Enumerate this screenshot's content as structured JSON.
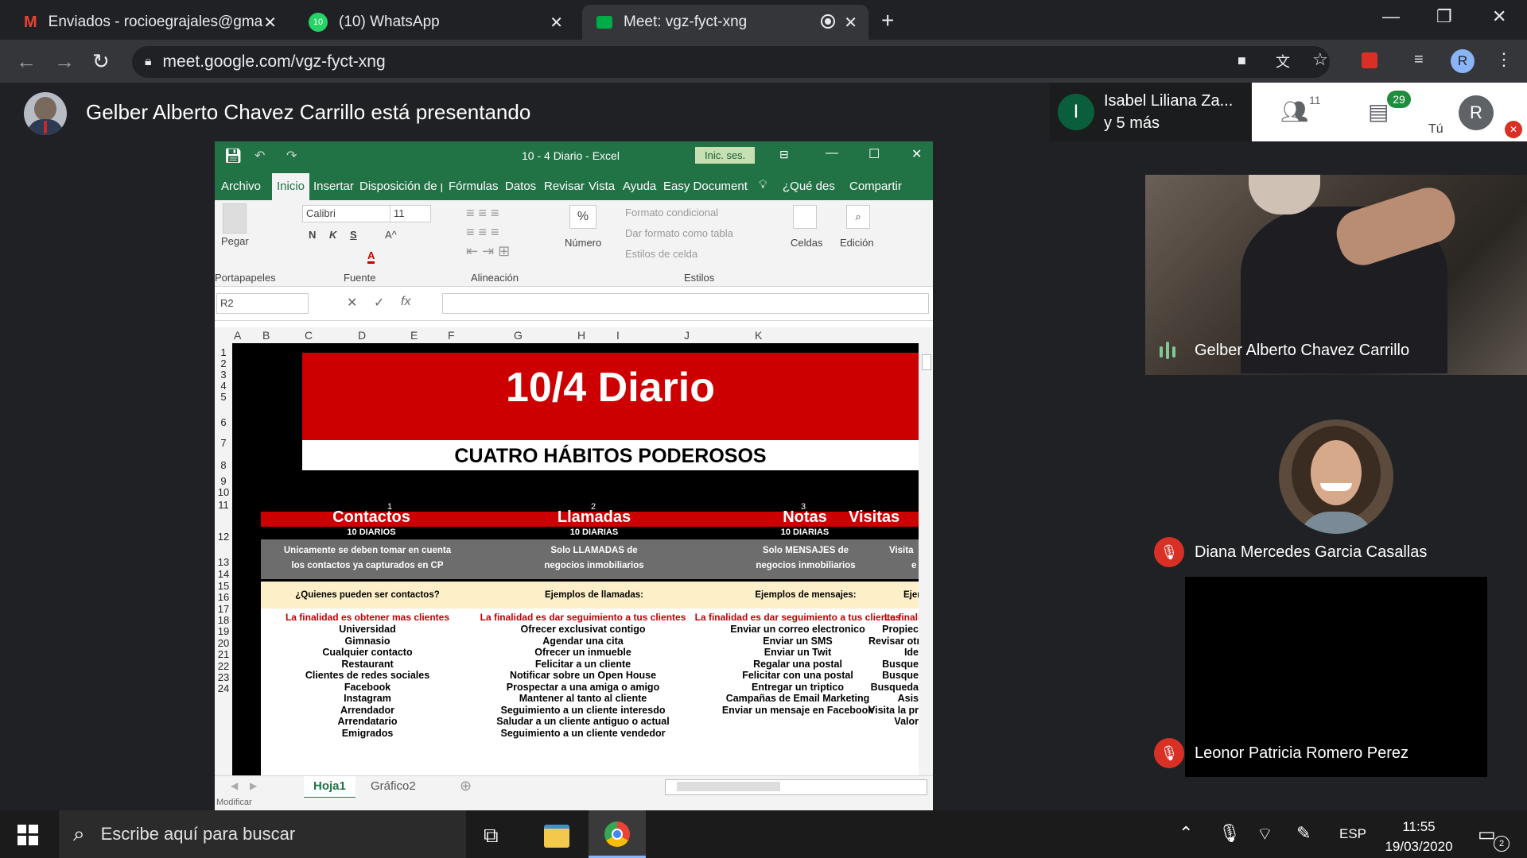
{
  "browser": {
    "tabs": [
      {
        "title": "Enviados - rocioegrajales@gmail",
        "icon": "gmail-icon"
      },
      {
        "title": "(10) WhatsApp",
        "badge": "10",
        "icon": "whatsapp-icon"
      },
      {
        "title": "Meet: vgz-fyct-xng",
        "icon": "meet-icon"
      }
    ],
    "url": "meet.google.com/vgz-fyct-xng",
    "profile_initial": "R"
  },
  "meet": {
    "presenter_text": "Gelber Alberto Chavez Carrillo está presentando",
    "people_summary_name": "Isabel Liliana Za...",
    "people_summary_more": "y 5 más",
    "people_avatar_initial": "I",
    "participants_count": "11",
    "chat_count": "29",
    "self_label": "Tú",
    "self_initial": "R",
    "tiles": [
      {
        "name": "Gelber Alberto Chavez Carrillo"
      },
      {
        "name": "Diana Mercedes Garcia Casallas"
      },
      {
        "name": "Leonor Patricia Romero Perez"
      }
    ]
  },
  "excel": {
    "window_title": "10 - 4 Diario  -  Excel",
    "signin": "Inic. ses.",
    "tabs": [
      "Archivo",
      "Inicio",
      "Insertar",
      "Disposición de p",
      "Fórmulas",
      "Datos",
      "Revisar",
      "Vista",
      "Ayuda",
      "Easy Document",
      "¿Qué des",
      "Compartir"
    ],
    "ribbon": {
      "paste": "Pegar",
      "clipboard": "Portapapeles",
      "font_name": "Calibri",
      "font_size": "11",
      "bold": "N",
      "italic": "K",
      "underline": "S",
      "font_group": "Fuente",
      "align_group": "Alineación",
      "number": "Número",
      "number_sym": "%",
      "cond_format": "Formato condicional",
      "table_format": "Dar formato como tabla",
      "cell_styles": "Estilos de celda",
      "styles_group": "Estilos",
      "cells": "Celdas",
      "edit": "Edición"
    },
    "name_box": "R2",
    "fx": "fx",
    "columns": [
      "A",
      "B",
      "C",
      "D",
      "E",
      "F",
      "G",
      "H",
      "I",
      "J",
      "K"
    ],
    "rows": [
      "1",
      "2",
      "3",
      "4",
      "5",
      "6",
      "7",
      "8",
      "9",
      "10",
      "11",
      "12",
      "13",
      "14",
      "15",
      "16",
      "17",
      "18",
      "19",
      "20",
      "21",
      "22",
      "23",
      "24"
    ],
    "sheet": {
      "title": "10/4 Diario",
      "subtitle": "CUATRO HÁBITOS PODEROSOS",
      "numbers": [
        "1",
        "2",
        "3"
      ],
      "headers": [
        "Contactos",
        "Llamadas",
        "Notas",
        "Visitas"
      ],
      "subheaders": [
        "10 DIARIOS",
        "10 DIARIAS",
        "10 DIARIAS"
      ],
      "desc": [
        [
          "Unicamente se deben tomar en cuenta",
          "los contactos ya capturados en CP"
        ],
        [
          "Solo LLAMADAS de",
          "negocios inmobiliarios"
        ],
        [
          "Solo MENSAJES de",
          "negocios inmobiliarios"
        ],
        [
          "Visita",
          "e"
        ]
      ],
      "questions": [
        "¿Quienes pueden ser contactos?",
        "Ejemplos de llamadas:",
        "Ejemplos de mensajes:",
        "Ejem"
      ],
      "goals": [
        "La finalidad es obtener mas clientes",
        "La finalidad es dar seguimiento a tus clientes",
        "La finalidad es dar seguimiento a tus clientes",
        "La finalidad"
      ],
      "col1": [
        "Universidad",
        "Gimnasio",
        "Cualquier contacto",
        "Restaurant",
        "Clientes de redes sociales",
        "Facebook",
        "Instagram",
        "Arrendador",
        "Arrendatario",
        "Emigrados"
      ],
      "col2": [
        "Ofrecer exclusivat contigo",
        "Agendar una cita",
        "Ofrecer un inmueble",
        "Felicitar a un cliente",
        "Notificar sobre un Open House",
        "Prospectar a una amiga o amigo",
        "Mantener al tanto al cliente",
        "Seguimiento a un cliente interesdo",
        "Saludar a un cliente antiguo o actual",
        "Seguimiento a un cliente vendedor"
      ],
      "col3": [
        "Enviar un correo electronico",
        "Enviar un SMS",
        "Enviar un Twit",
        "Regalar una postal",
        "Felicitar con una postal",
        "Entregar un triptico",
        "Campañas de Email Marketing",
        "Enviar un mensaje en Facebook"
      ],
      "col4": [
        "Propiec",
        "Revisar otr",
        "Ide",
        "Busque",
        "Busque",
        "Busqueda",
        "Asis",
        "Visita la prop",
        "Valor"
      ]
    },
    "sheet_tabs": [
      "Hoja1",
      "Gráfico2"
    ],
    "status": "Modificar"
  },
  "taskbar": {
    "search_placeholder": "Escribe aquí para buscar",
    "language": "ESP",
    "time": "11:55",
    "date": "19/03/2020",
    "notif_count": "2"
  },
  "colors": {
    "excel_green": "#217346",
    "banner_red": "#cc0000",
    "meet_bg": "#202124",
    "mute_red": "#d93025"
  }
}
